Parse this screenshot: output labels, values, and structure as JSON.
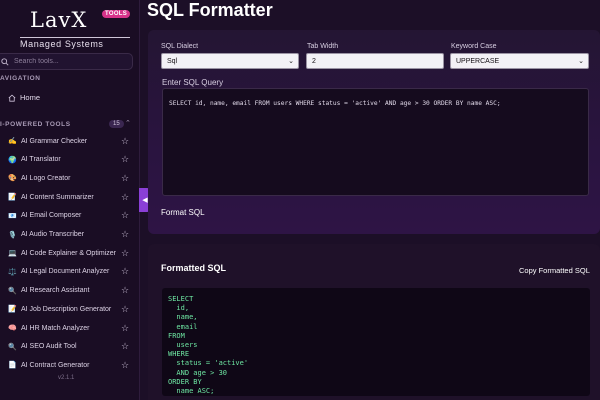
{
  "sidebar": {
    "logo": "LavX",
    "logo_sub": "Managed Systems",
    "badge": "TOOLS",
    "search_placeholder": "Search tools...",
    "nav_label": "AVIGATION",
    "home": "Home",
    "tools_label": "I-POWERED TOOLS",
    "tools_count": "15",
    "tools": [
      {
        "emoji": "✍️",
        "label": "AI Grammar Checker"
      },
      {
        "emoji": "🌍",
        "label": "AI Translator"
      },
      {
        "emoji": "🎨",
        "label": "AI Logo Creator"
      },
      {
        "emoji": "📝",
        "label": "AI Content Summarizer"
      },
      {
        "emoji": "📧",
        "label": "AI Email Composer"
      },
      {
        "emoji": "🎙️",
        "label": "AI Audio Transcriber"
      },
      {
        "emoji": "💻",
        "label": "AI Code Explainer & Optimizer"
      },
      {
        "emoji": "⚖️",
        "label": "AI Legal Document Analyzer"
      },
      {
        "emoji": "🔍",
        "label": "AI Research Assistant"
      },
      {
        "emoji": "📝",
        "label": "AI Job Description Generator"
      },
      {
        "emoji": "🧠",
        "label": "AI HR Match Analyzer"
      },
      {
        "emoji": "🔍",
        "label": "AI SEO Audit Tool"
      },
      {
        "emoji": "📄",
        "label": "AI Contract Generator"
      }
    ],
    "version": "v2.1.1"
  },
  "main": {
    "title": "SQL Formatter",
    "dialect_label": "SQL Dialect",
    "dialect_value": "Sql",
    "tab_label": "Tab Width",
    "tab_value": "2",
    "case_label": "Keyword Case",
    "case_value": "UPPERCASE",
    "query_label": "Enter SQL Query",
    "query_value": "SELECT id, name, email FROM users WHERE status = 'active' AND age > 30 ORDER BY name ASC;",
    "format_button": "Format SQL",
    "output_title": "Formatted SQL",
    "copy_button": "Copy Formatted SQL",
    "output_value": "SELECT\n  id,\n  name,\n  email\nFROM\n  users\nWHERE\n  status = 'active'\n  AND age > 30\nORDER BY\n  name ASC;"
  }
}
